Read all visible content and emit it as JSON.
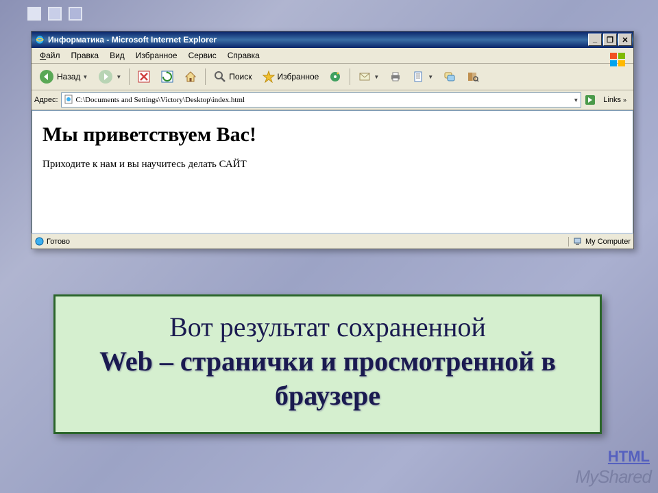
{
  "titlebar": {
    "title": "Информатика - Microsoft Internet Explorer",
    "min": "_",
    "max": "❐",
    "close": "✕"
  },
  "menu": {
    "file": "Файл",
    "edit": "Правка",
    "view": "Вид",
    "favorites": "Избранное",
    "tools": "Сервис",
    "help": "Справка"
  },
  "toolbar": {
    "back": "Назад",
    "search": "Поиск",
    "favorites": "Избранное"
  },
  "address": {
    "label": "Адрес:",
    "value": "C:\\Documents and Settings\\Victory\\Desktop\\index.html",
    "links": "Links"
  },
  "page": {
    "heading": "Мы приветствуем Вас!",
    "paragraph": "Приходите к нам и вы научитесь делать САЙТ"
  },
  "status": {
    "ready": "Готово",
    "zone": "My Computer"
  },
  "caption": {
    "line1": "Вот результат сохраненной",
    "line2": "Web – странички и просмотренной в браузере"
  },
  "watermark": "MyShared",
  "corner_link": "HTML"
}
